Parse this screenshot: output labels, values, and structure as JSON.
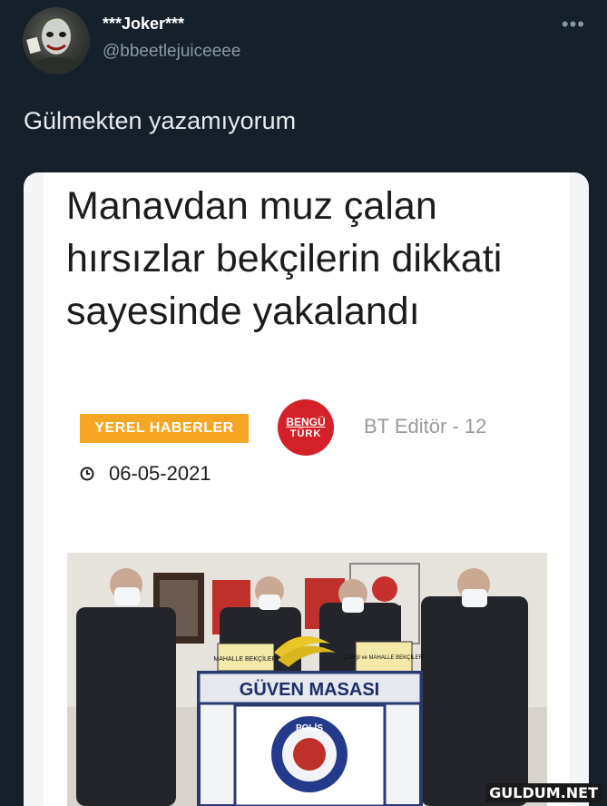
{
  "tweet": {
    "display_name": "***Joker***",
    "handle": "@bbeetlejuiceeee",
    "more_icon": "more-horizontal-icon",
    "text": "Gülmekten yazamıyorum"
  },
  "article": {
    "headline": "Manavdan muz çalan hırsızlar bekçilerin dikkati sayesinde yakalandı",
    "category": "YEREL HABERLER",
    "logo_top": "BENGÜ",
    "logo_bottom": "TÜRK",
    "author": "BT Editör - 12",
    "date": "06-05-2021",
    "photo": {
      "desk_text": "GÜVEN MASASI",
      "sign_left": "MAHALLE BEKÇİLERİ",
      "sign_right": "ÇARŞI ve MAHALLE BEKÇİLERİ",
      "badge_text": "POLİS"
    }
  },
  "watermark": "GULDUM.NET",
  "colors": {
    "background": "#15202b",
    "category_tag": "#f5a623",
    "logo_red": "#d42028"
  }
}
